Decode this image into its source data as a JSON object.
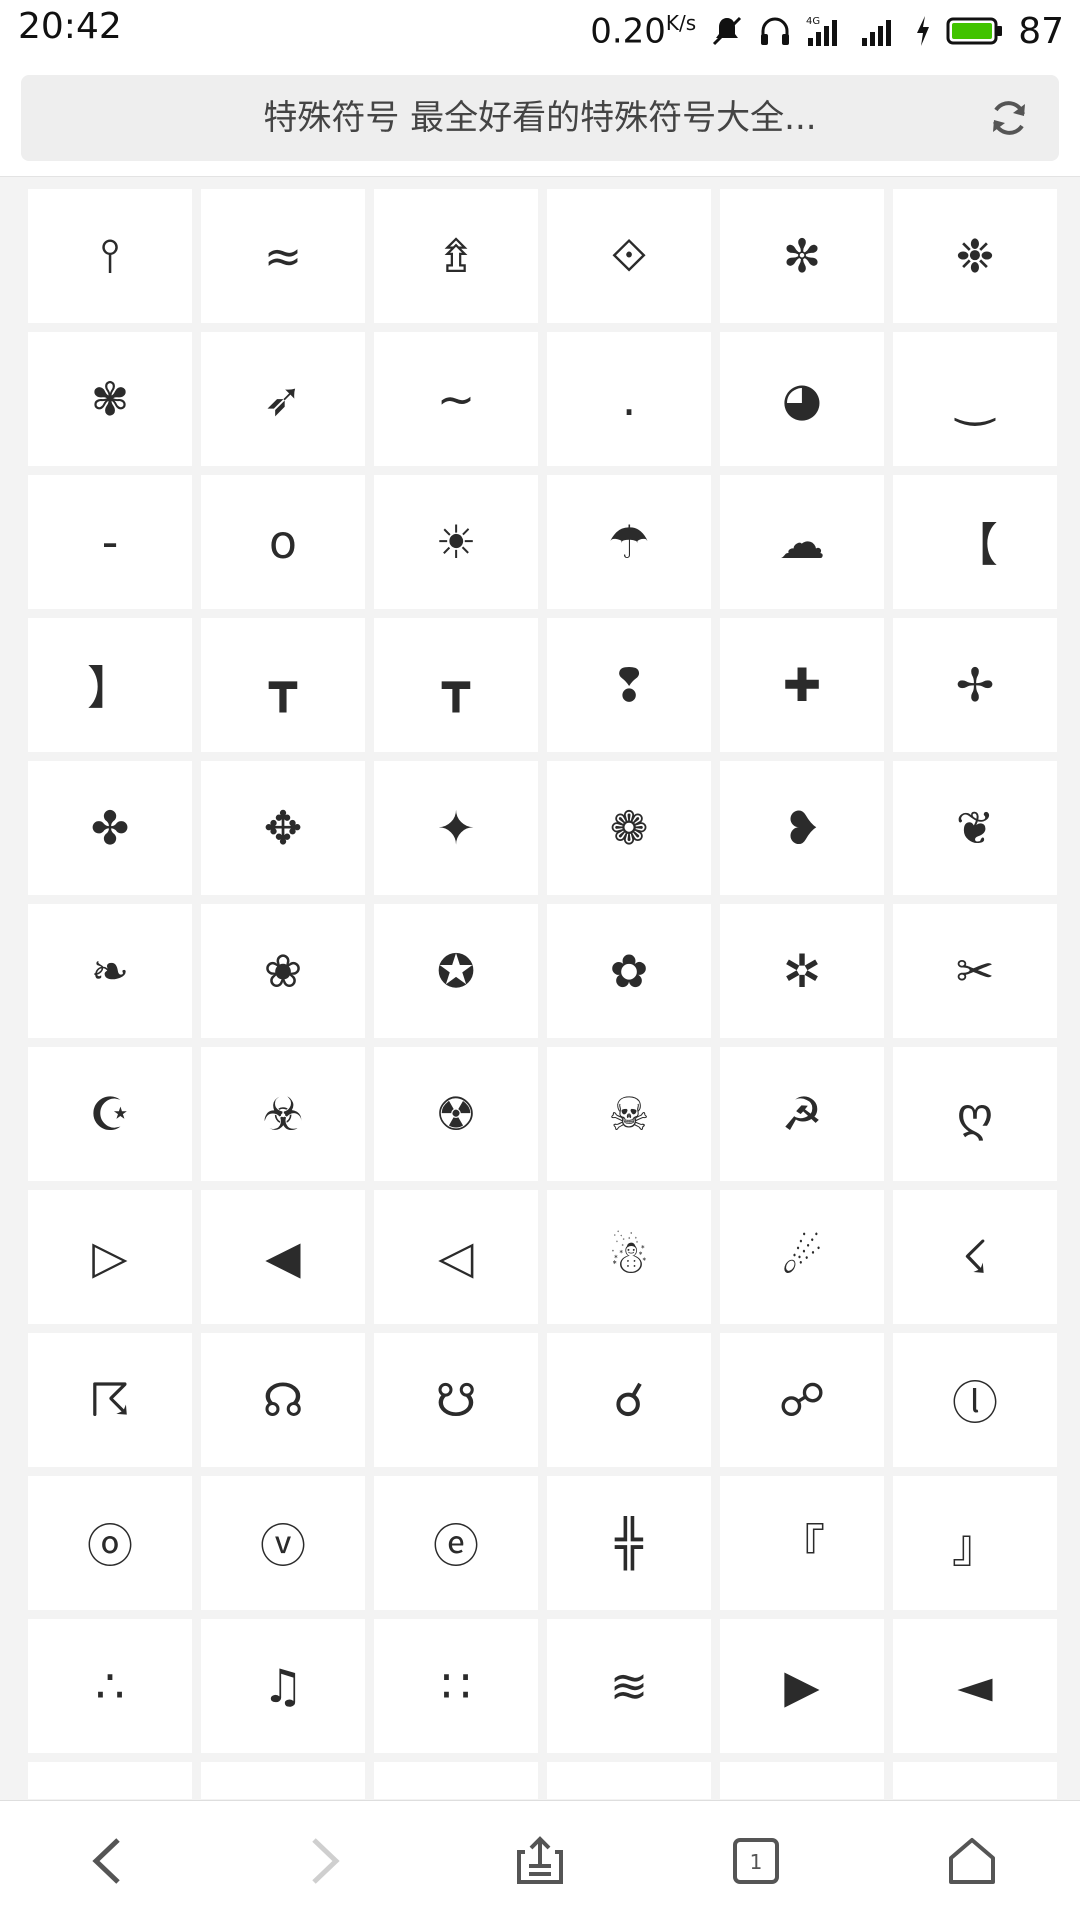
{
  "status_bar": {
    "time": "20:42",
    "speed": "0.20",
    "speed_unit": "K/s",
    "battery_percent": "87",
    "icons": [
      "mute-icon",
      "headphones-icon",
      "signal-4g-icon",
      "signal-icon",
      "charging-icon",
      "battery-icon"
    ],
    "battery_color": "#41c300"
  },
  "url_bar": {
    "title": "特殊符号 最全好看的特殊符号大全...",
    "reload_icon": "reload-icon"
  },
  "symbols": [
    "⫯",
    "≈",
    "⇯",
    "⟐",
    "✼",
    "❉",
    "✾",
    "➶",
    "~",
    ".",
    "◕",
    "‿",
    "-",
    "o",
    "☀",
    "☂",
    "☁",
    "【",
    "】",
    "┳",
    "┳",
    "❢",
    "✚",
    "✢",
    "✤",
    "✥",
    "✦",
    "❁",
    "❥",
    "❦",
    "❧",
    "❀",
    "✪",
    "✿",
    "✲",
    "✂",
    "☪",
    "☣",
    "☢",
    "☠",
    "☭",
    "ღ",
    "▷",
    "◀",
    "◁",
    "☃",
    "☄",
    "☇",
    "☈",
    "☊",
    "☋",
    "☌",
    "☍",
    "ⓛ",
    "ⓞ",
    "ⓥ",
    "ⓔ",
    "╬",
    "『",
    "』",
    "∴",
    "♫",
    "∷",
    "≋",
    "▶",
    "◄",
    "",
    "",
    "",
    "",
    "",
    ""
  ],
  "bottom_nav": {
    "back_icon": "back-icon",
    "forward_icon": "forward-icon",
    "share_icon": "share-icon",
    "tabs_count": "1",
    "home_icon": "home-icon"
  }
}
